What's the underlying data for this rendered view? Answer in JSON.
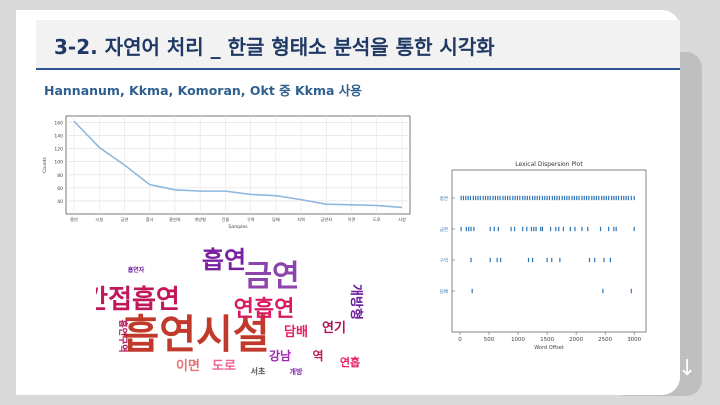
{
  "slide": {
    "title": "3-2. 자연어 처리 _ 한글 형태소 분석을 통한 시각화",
    "subtitle": "Hannanum, Kkma, Komoran, Okt  중 Kkma 사용",
    "nav_icon": "arrow-down-icon",
    "nav_glyph": "↓"
  },
  "chart_data": [
    {
      "type": "line",
      "ylabel": "Counts",
      "xlabel": "Samples",
      "x": [
        "흡연",
        "시설",
        "금연",
        "흡사",
        "흡연자",
        "개방형",
        "건물",
        "구역",
        "담배",
        "지역",
        "금연자",
        "이면",
        "도로",
        "시청"
      ],
      "series": [
        {
          "values": [
            162,
            122,
            95,
            65,
            57,
            55,
            55,
            50,
            48,
            42,
            35,
            34,
            33,
            30
          ]
        }
      ],
      "ylim": [
        20,
        170
      ],
      "yticks": [
        40,
        60,
        80,
        100,
        120,
        140,
        160
      ],
      "grid": true
    },
    {
      "type": "scatter",
      "title": "Lexical Dispersion Plot",
      "xlabel": "Word Offset",
      "xlim": [
        0,
        3100
      ],
      "xticks": [
        0,
        500,
        1000,
        1500,
        2000,
        2500,
        3000
      ],
      "categories": [
        "흡연",
        "금연",
        "구역",
        "담배"
      ],
      "series": [
        {
          "name": "흡연",
          "values": [
            20,
            60,
            100,
            140,
            180,
            230,
            270,
            310,
            350,
            400,
            440,
            480,
            520,
            570,
            610,
            650,
            690,
            740,
            780,
            820,
            860,
            910,
            950,
            990,
            1030,
            1080,
            1120,
            1160,
            1200,
            1250,
            1290,
            1330,
            1370,
            1420,
            1460,
            1500,
            1540,
            1590,
            1630,
            1670,
            1710,
            1760,
            1800,
            1840,
            1880,
            1930,
            1970,
            2010,
            2050,
            2100,
            2140,
            2180,
            2220,
            2270,
            2310,
            2350,
            2390,
            2440,
            2480,
            2520,
            2560,
            2610,
            2650,
            2690,
            2730,
            2780,
            2820,
            2860,
            2900,
            2950,
            3000
          ]
        },
        {
          "name": "금연",
          "values": [
            20,
            110,
            150,
            190,
            240,
            520,
            590,
            660,
            880,
            940,
            1080,
            1150,
            1230,
            1270,
            1310,
            1390,
            1420,
            1560,
            1650,
            1700,
            1780,
            1900,
            1980,
            2100,
            2200,
            2420,
            2560,
            2650,
            2690,
            3000
          ]
        },
        {
          "name": "구역",
          "values": [
            190,
            520,
            640,
            700,
            1180,
            1250,
            1500,
            1580,
            1720,
            2230,
            2320,
            2480,
            2590
          ]
        },
        {
          "name": "담배",
          "values": [
            210,
            2460,
            2950
          ]
        }
      ]
    },
    {
      "type": "wordcloud",
      "words": [
        "흡연시설",
        "금연",
        "간접흡연",
        "흡연",
        "연흡연",
        "개방형",
        "담배",
        "연기",
        "강남",
        "역",
        "이면",
        "도로",
        "서초",
        "흡연자",
        "흡연구역",
        "개방",
        "연흡"
      ]
    }
  ]
}
